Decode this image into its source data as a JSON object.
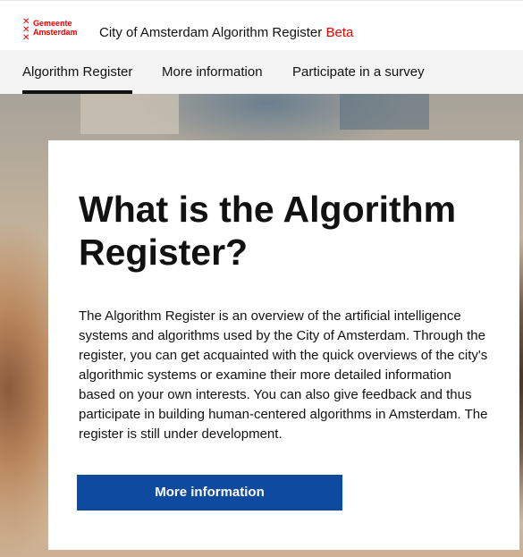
{
  "logo": {
    "lines": [
      "Gemeente",
      "Amsterdam"
    ],
    "crosses": "✕✕✕",
    "color": "#ec0000"
  },
  "header": {
    "title": "City of Amsterdam Algorithm Register",
    "beta": "Beta"
  },
  "nav": {
    "items": [
      {
        "label": "Algorithm Register",
        "active": true
      },
      {
        "label": "More information",
        "active": false
      },
      {
        "label": "Participate in a survey",
        "active": false
      }
    ]
  },
  "card": {
    "title": "What is the Algorithm Register?",
    "body": "The Algorithm Register is an overview of the artificial intelligence systems and algorithms used by the City of Amsterdam. Through the register, you can get acquainted with the quick overviews of the city's algorithmic systems or examine their more detailed information based on your own interests. You can also give feedback and thus participate in building human-centered algorithms in Amsterdam. The register is still under development.",
    "button_label": "More information"
  },
  "colors": {
    "brand_red": "#ec0000",
    "button_blue": "#0e4a9f",
    "nav_bg": "#f3f3f3"
  }
}
